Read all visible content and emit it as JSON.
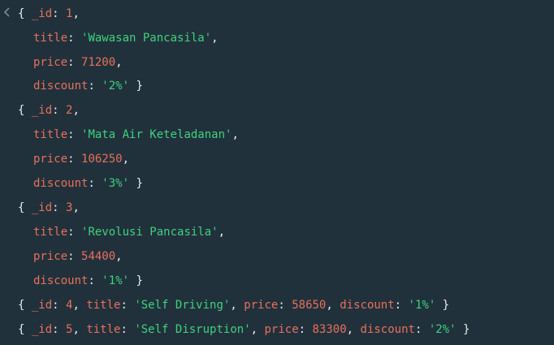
{
  "colors": {
    "background": "#21313c",
    "key": "#e8705a",
    "string": "#3ed27d",
    "number": "#e8705a",
    "punct": "#e8edeb",
    "icon": "#7d8a92"
  },
  "prompt_icon": "chevron-left-icon",
  "punct": {
    "open": "{ ",
    "close": " }",
    "comma": ",",
    "colon": ": ",
    "sep": ", "
  },
  "docs": [
    {
      "id_key": "_id",
      "id": "1",
      "title_key": "title",
      "title": "'Wawasan Pancasila'",
      "price_key": "price",
      "price": "71200",
      "discount_key": "discount",
      "discount": "'2%'"
    },
    {
      "id_key": "_id",
      "id": "2",
      "title_key": "title",
      "title": "'Mata Air Keteladanan'",
      "price_key": "price",
      "price": "106250",
      "discount_key": "discount",
      "discount": "'3%'"
    },
    {
      "id_key": "_id",
      "id": "3",
      "title_key": "title",
      "title": "'Revolusi Pancasila'",
      "price_key": "price",
      "price": "54400",
      "discount_key": "discount",
      "discount": "'1%'"
    },
    {
      "id_key": "_id",
      "id": "4",
      "title_key": "title",
      "title": "'Self Driving'",
      "price_key": "price",
      "price": "58650",
      "discount_key": "discount",
      "discount": "'1%'"
    },
    {
      "id_key": "_id",
      "id": "5",
      "title_key": "title",
      "title": "'Self Disruption'",
      "price_key": "price",
      "price": "83300",
      "discount_key": "discount",
      "discount": "'2%'"
    }
  ]
}
